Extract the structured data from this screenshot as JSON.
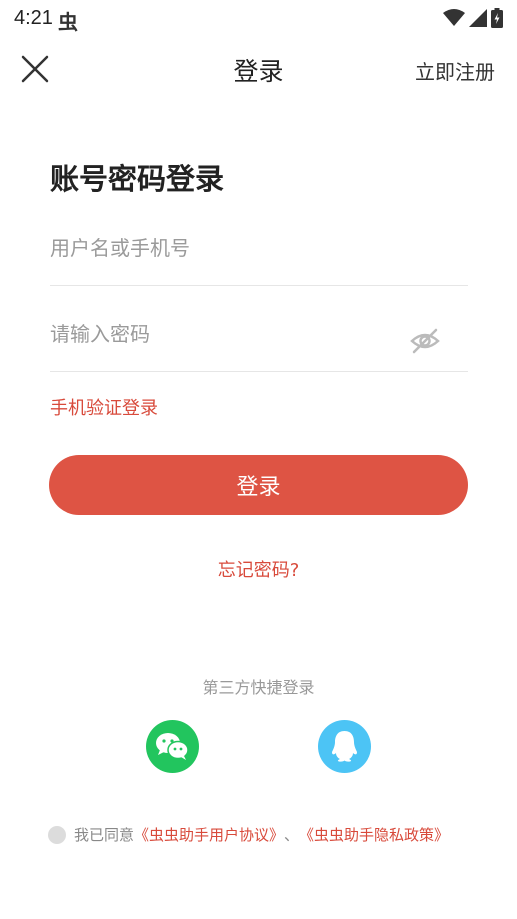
{
  "status_bar": {
    "time": "4:21",
    "app_icon": "虫"
  },
  "nav": {
    "title": "登录",
    "register": "立即注册"
  },
  "heading": "账号密码登录",
  "username": {
    "placeholder": "用户名或手机号",
    "value": ""
  },
  "password": {
    "placeholder": "请输入密码",
    "value": ""
  },
  "sms_login": "手机验证登录",
  "login_button": "登录",
  "forgot_password": "忘记密码?",
  "third_party": {
    "label": "第三方快捷登录",
    "providers": [
      "wechat-icon",
      "qq-icon"
    ]
  },
  "agreement": {
    "prefix": "我已同意",
    "user_agreement": "《虫虫助手用户协议》",
    "separator": "、",
    "privacy_policy": "《虫虫助手隐私政策》"
  },
  "colors": {
    "accent": "#de5444",
    "link": "#d84a3b",
    "wechat": "#22c55e",
    "qq": "#4cc4f5"
  }
}
